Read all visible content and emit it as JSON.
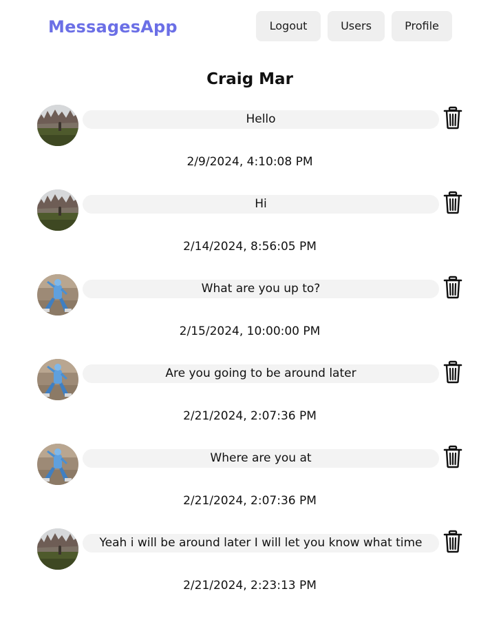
{
  "nav": {
    "brand": "MessagesApp",
    "logout_label": "Logout",
    "users_label": "Users",
    "profile_label": "Profile",
    "brand_color": "#6b6fe6"
  },
  "chat": {
    "title": "Craig Mar"
  },
  "messages": [
    {
      "text": "Hello",
      "timestamp": "2/9/2024, 4:10:08 PM",
      "avatar": "landscape-avatar"
    },
    {
      "text": "Hi",
      "timestamp": "2/14/2024, 8:56:05 PM",
      "avatar": "landscape-avatar"
    },
    {
      "text": "What are you up to?",
      "timestamp": "2/15/2024, 10:00:00 PM",
      "avatar": "robot-avatar"
    },
    {
      "text": "Are you going to be around later",
      "timestamp": "2/21/2024, 2:07:36 PM",
      "avatar": "robot-avatar"
    },
    {
      "text": "Where are you at",
      "timestamp": "2/21/2024, 2:07:36 PM",
      "avatar": "robot-avatar"
    },
    {
      "text": "Yeah i will be around later I will let you know what time",
      "timestamp": "2/21/2024, 2:23:13 PM",
      "avatar": "landscape-avatar"
    }
  ],
  "icons": {
    "delete": "trash-icon"
  }
}
